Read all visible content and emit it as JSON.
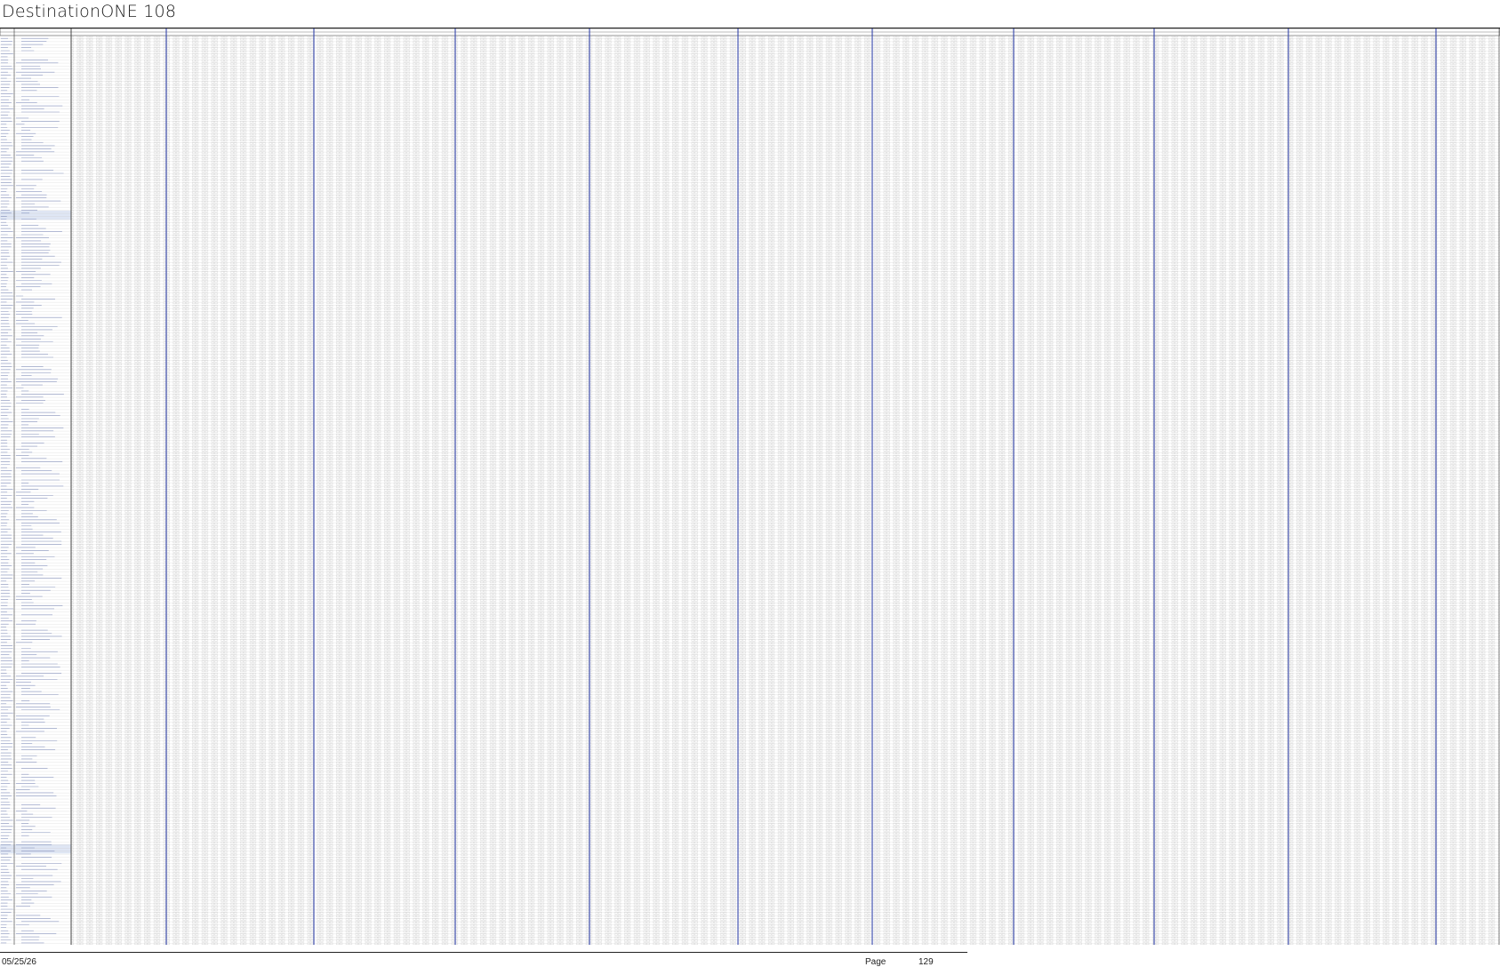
{
  "document": {
    "title": "DestinationONE 108"
  },
  "footer": {
    "date": "05/25/26",
    "page_label": "Page",
    "page_number": "129"
  },
  "colors": {
    "grid_line": "#c8c8c8",
    "cell_box": "#bdbdbd",
    "section_divider": "#3344aa",
    "text_faint": "#6a7ab0",
    "row_highlight": "#dfe6f4"
  }
}
